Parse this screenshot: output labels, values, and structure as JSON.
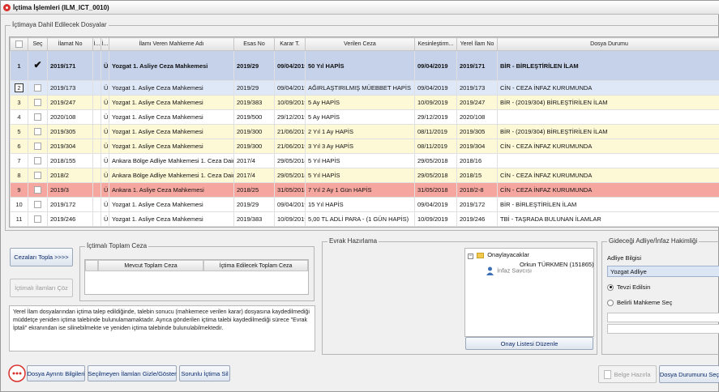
{
  "window": {
    "title": "İçtima İşlemleri (ILM_ICT_0010)"
  },
  "files_group": {
    "legend": "İçtimaya Dahil Edilecek Dosyalar"
  },
  "columns": [
    "Seç",
    "İlamat No",
    "İ...",
    "İ...",
    "İlamı Veren Mahkeme Adı",
    "Esas No",
    "Karar T.",
    "Verilen Ceza",
    "Kesinleştirm...",
    "Yerel İlam No",
    "Dosya Durumu"
  ],
  "rows": [
    {
      "n": "1",
      "checked": true,
      "ilamat": "2019/171",
      "a": "",
      "b": "Ü...",
      "mahkeme": "Yozgat 1. Asliye Ceza Mahkemesi",
      "esas": "2019/29",
      "karar": "09/04/2019",
      "ceza": "50 Yıl HAPİS",
      "kesin": "09/04/2019",
      "yerel": "2019/171",
      "durum": "BİR - BİRLEŞTİRİLEN İLAM",
      "style": "row-1"
    },
    {
      "n": "2",
      "checked": false,
      "ilamat": "2019/173",
      "a": "",
      "b": "Ü...",
      "mahkeme": "Yozgat 1. Asliye Ceza Mahkemesi",
      "esas": "2019/29",
      "karar": "09/04/2019",
      "ceza": "AĞIRLAŞTIRILMIŞ MÜEBBET HAPİS",
      "kesin": "09/04/2019",
      "yerel": "2019/173",
      "durum": "CİN - CEZA İNFAZ KURUMUNDA",
      "style": "row-2"
    },
    {
      "n": "3",
      "checked": false,
      "ilamat": "2019/247",
      "a": "",
      "b": "Ü...",
      "mahkeme": "Yozgat 1. Asliye Ceza Mahkemesi",
      "esas": "2019/383",
      "karar": "10/09/2019",
      "ceza": "5 Ay HAPİS",
      "kesin": "10/09/2019",
      "yerel": "2019/247",
      "durum": "BİR - (2019/304) BİRLEŞTİRİLEN İLAM",
      "style": "row-yellow"
    },
    {
      "n": "4",
      "checked": false,
      "ilamat": "2020/108",
      "a": "",
      "b": "Ü...",
      "mahkeme": "Yozgat 1. Asliye Ceza Mahkemesi",
      "esas": "2019/500",
      "karar": "29/12/2019",
      "ceza": "5 Ay HAPİS",
      "kesin": "29/12/2019",
      "yerel": "2020/108",
      "durum": "",
      "style": "row-white"
    },
    {
      "n": "5",
      "checked": false,
      "ilamat": "2019/305",
      "a": "",
      "b": "Ü...",
      "mahkeme": "Yozgat 1. Asliye Ceza Mahkemesi",
      "esas": "2019/300",
      "karar": "21/06/2019",
      "ceza": "2 Yıl 1 Ay HAPİS",
      "kesin": "08/11/2019",
      "yerel": "2019/305",
      "durum": "BİR - (2019/304) BİRLEŞTİRİLEN İLAM",
      "style": "row-yellow"
    },
    {
      "n": "6",
      "checked": false,
      "ilamat": "2019/304",
      "a": "",
      "b": "Ü...",
      "mahkeme": "Yozgat 1. Asliye Ceza Mahkemesi",
      "esas": "2019/300",
      "karar": "21/06/2019",
      "ceza": "3 Yıl 3 Ay HAPİS",
      "kesin": "08/11/2019",
      "yerel": "2019/304",
      "durum": "CİN - CEZA İNFAZ KURUMUNDA",
      "style": "row-yellow"
    },
    {
      "n": "7",
      "checked": false,
      "ilamat": "2018/155",
      "a": "",
      "b": "Ü...",
      "mahkeme": "Ankara Bölge Adliye Mahkemesi 1. Ceza Daire...",
      "esas": "2017/4",
      "karar": "29/05/2018",
      "ceza": "5 Yıl HAPİS",
      "kesin": "29/05/2018",
      "yerel": "2018/16",
      "durum": "",
      "style": "row-white"
    },
    {
      "n": "8",
      "checked": false,
      "ilamat": "2018/2",
      "a": "",
      "b": "Ü...",
      "mahkeme": "Ankara Bölge Adliye Mahkemesi 1. Ceza Daire...",
      "esas": "2017/4",
      "karar": "29/05/2018",
      "ceza": "5 Yıl HAPİS",
      "kesin": "29/05/2018",
      "yerel": "2018/15",
      "durum": "CİN - CEZA İNFAZ KURUMUNDA",
      "style": "row-yellow"
    },
    {
      "n": "9",
      "checked": false,
      "ilamat": "2019/3",
      "a": "",
      "b": "Ü...",
      "mahkeme": "Ankara 1. Asliye Ceza Mahkemesi",
      "esas": "2018/25",
      "karar": "31/05/2018",
      "ceza": "7 Yıl 2 Ay 1 Gün HAPİS",
      "kesin": "31/05/2018",
      "yerel": "2018/2-8",
      "durum": "CİN - CEZA İNFAZ KURUMUNDA",
      "style": "row-red"
    },
    {
      "n": "10",
      "checked": false,
      "ilamat": "2019/172",
      "a": "",
      "b": "Ü...",
      "mahkeme": "Yozgat 1. Asliye Ceza Mahkemesi",
      "esas": "2019/29",
      "karar": "09/04/2019",
      "ceza": "15 Yıl HAPİS",
      "kesin": "09/04/2019",
      "yerel": "2019/172",
      "durum": "BİR - BİRLEŞTİRİLEN İLAM",
      "style": "row-white"
    },
    {
      "n": "11",
      "checked": false,
      "ilamat": "2019/246",
      "a": "",
      "b": "Ü...",
      "mahkeme": "Yozgat 1. Asliye Ceza Mahkemesi",
      "esas": "2019/383",
      "karar": "10/09/2019",
      "ceza": "5,00 TL ADLİ PARA - (1 GÜN HAPİS)",
      "kesin": "10/09/2019",
      "yerel": "2019/246",
      "durum": "TBİ - TAŞRADA BULUNAN İLAMLAR",
      "style": "row-white"
    }
  ],
  "buttons": {
    "cezalari_topla": "Cezaları Topla >>>>",
    "ictimali_coz": "İçtimalı İlamları Çöz",
    "dosya_ayrinti": "Dosya Ayrıntı Bilgileri",
    "secilmeyen_gizle": "Seçilmeyen İlamları Gizle/Göster",
    "sorunlu_ictima": "Sorunlu İçtima Sil",
    "onay_listesi": "Onay Listesi Düzenle",
    "belge_hazirla": "Belge Hazırla",
    "dosya_durumu": "Dosya Durumunu Seç"
  },
  "toplam_group": {
    "legend": "İçtimalı Toplam Ceza",
    "col1": "Mevcut Toplam Ceza",
    "col2": "İçtima Edilecek Toplam Ceza"
  },
  "info": {
    "text": "Yerel İlam dosyalarından içtima talep edildiğinde, talebin sonucu (mahkemece verilen karar) dosyasına kaydedilmediği müddetçe yeniden içtima talebinde bulunulamamaktadır. Ayrıca gönderilen içtima talebi kaydedilmediği sürece \"Evrak İptali\" ekranından ise silinebilmekte ve yeniden içtima talebinde bulunulabilmektedir."
  },
  "evrak_group": {
    "legend": "Evrak Hazırlama"
  },
  "tree": {
    "root": "Onaylayacaklar",
    "person": "Orkun TÜRKMEN (151865)",
    "role": "İnfaz Savcısı"
  },
  "gidecegi_group": {
    "legend": "Gideceği Adliye/İnfaz Hakimliği",
    "adliye_label": "Adliye Bilgisi",
    "adliye_value": "Yozgat Adliye",
    "radio1": "Tevzi Edilsin",
    "radio2": "Belirli Mahkeme Seç"
  },
  "colors": {
    "selected_row": "#c5d2ea",
    "highlight_yellow": "#fdf8d6",
    "highlight_red": "#f5a79f"
  }
}
